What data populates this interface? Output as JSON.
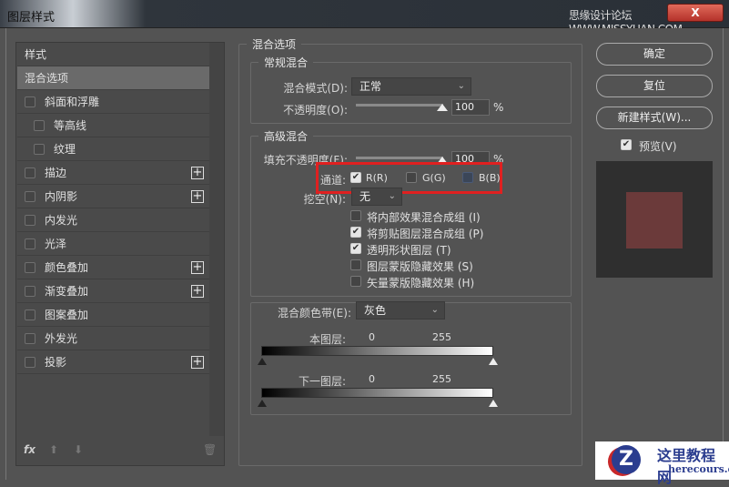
{
  "window": {
    "title": "图层样式",
    "watermark": "思缘设计论坛 WWW.MISSYUAN.COM",
    "close": "X"
  },
  "sidebar": {
    "header": "样式",
    "items": [
      {
        "label": "混合选项",
        "checkbox": false,
        "plus": false,
        "selected": true,
        "indent": false
      },
      {
        "label": "斜面和浮雕",
        "checkbox": true,
        "plus": false,
        "indent": false
      },
      {
        "label": "等高线",
        "checkbox": true,
        "plus": false,
        "indent": true
      },
      {
        "label": "纹理",
        "checkbox": true,
        "plus": false,
        "indent": true
      },
      {
        "label": "描边",
        "checkbox": true,
        "plus": true,
        "indent": false
      },
      {
        "label": "内阴影",
        "checkbox": true,
        "plus": true,
        "indent": false
      },
      {
        "label": "内发光",
        "checkbox": true,
        "plus": false,
        "indent": false
      },
      {
        "label": "光泽",
        "checkbox": true,
        "plus": false,
        "indent": false
      },
      {
        "label": "颜色叠加",
        "checkbox": true,
        "plus": true,
        "indent": false
      },
      {
        "label": "渐变叠加",
        "checkbox": true,
        "plus": true,
        "indent": false
      },
      {
        "label": "图案叠加",
        "checkbox": true,
        "plus": false,
        "indent": false
      },
      {
        "label": "外发光",
        "checkbox": true,
        "plus": false,
        "indent": false
      },
      {
        "label": "投影",
        "checkbox": true,
        "plus": true,
        "indent": false
      }
    ],
    "fx": "fx"
  },
  "blend": {
    "title": "混合选项",
    "general": {
      "title": "常规混合",
      "mode_label": "混合模式(D):",
      "mode_value": "正常",
      "opacity_label": "不透明度(O):",
      "opacity_value": "100",
      "percent": "%"
    },
    "advanced": {
      "title": "高级混合",
      "fill_label": "填充不透明度(F):",
      "fill_value": "100",
      "percent": "%",
      "channels_label": "通道:",
      "r": "R(R)",
      "g": "G(G)",
      "b": "B(B)",
      "knockout_label": "挖空(N):",
      "knockout_value": "无",
      "options": [
        {
          "label": "将内部效果混合成组 (I)",
          "checked": false
        },
        {
          "label": "将剪贴图层混合成组 (P)",
          "checked": true
        },
        {
          "label": "透明形状图层 (T)",
          "checked": true
        },
        {
          "label": "图层蒙版隐藏效果 (S)",
          "checked": false
        },
        {
          "label": "矢量蒙版隐藏效果 (H)",
          "checked": false
        }
      ]
    },
    "band": {
      "label": "混合颜色带(E):",
      "value": "灰色",
      "this_layer": "本图层:",
      "under_layer": "下一图层:",
      "min": "0",
      "max": "255"
    }
  },
  "buttons": {
    "ok": "确定",
    "reset": "复位",
    "new_style": "新建样式(W)...",
    "preview": "预览(V)"
  },
  "preview": {
    "bg": "#2f2f2f",
    "swatch": "#6b3a3a"
  },
  "logo": {
    "title": "这里教程网",
    "url": "herecours.com"
  },
  "highlight_color": "#e02020"
}
